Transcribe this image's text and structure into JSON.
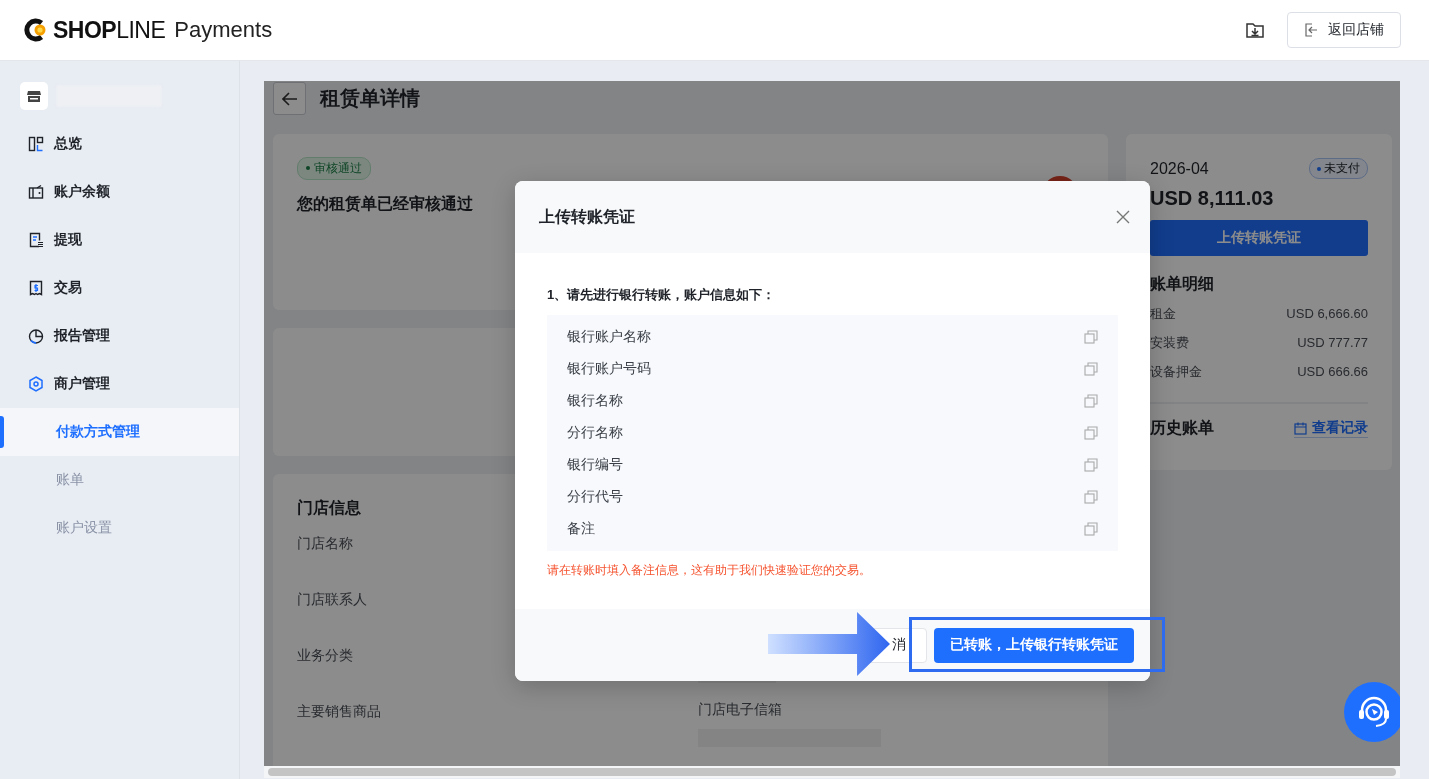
{
  "header": {
    "brand": "**SHOP**LINE",
    "product": "Payments",
    "back_button": "返回店铺"
  },
  "sidebar": {
    "items": [
      {
        "label": "总览",
        "expanded": false
      },
      {
        "label": "账户余额",
        "expanded": false
      },
      {
        "label": "提现",
        "expanded": false
      },
      {
        "label": "交易",
        "expanded": false
      },
      {
        "label": "报告管理",
        "expanded": false
      },
      {
        "label": "商户管理",
        "expanded": true,
        "children": [
          {
            "label": "付款方式管理",
            "selected": true
          },
          {
            "label": "账单",
            "selected": false
          },
          {
            "label": "账户设置",
            "selected": false
          }
        ]
      }
    ]
  },
  "page": {
    "title": "租赁单详情",
    "status_tag": "审核通过",
    "status_message": "您的租赁单已经审核通过",
    "store_info": {
      "title": "门店信息",
      "left_fields": [
        {
          "label": "门店名称"
        },
        {
          "label": "门店联系人"
        },
        {
          "label": "业务分类"
        },
        {
          "label": "主要销售商品"
        }
      ],
      "right_fields": [
        {
          "label": "门店电子信箱"
        }
      ]
    },
    "bill": {
      "period": "2026-04",
      "status": "未支付",
      "amount": "USD 8,111.03",
      "upload_button": "上传转账凭证",
      "details_title": "账单明细",
      "lines": [
        {
          "label": "租金",
          "amount": "USD 6,666.60"
        },
        {
          "label": "安装费",
          "amount": "USD 777.77"
        },
        {
          "label": "设备押金",
          "amount": "USD 666.66"
        }
      ],
      "history_title": "历史账单",
      "history_link": "查看记录"
    }
  },
  "modal": {
    "title": "上传转账凭证",
    "step": "1、请先进行银行转账，账户信息如下：",
    "fields": [
      {
        "label": "银行账户名称"
      },
      {
        "label": "银行账户号码"
      },
      {
        "label": "银行名称"
      },
      {
        "label": "分行名称"
      },
      {
        "label": "银行编号"
      },
      {
        "label": "分行代号"
      },
      {
        "label": "备注"
      }
    ],
    "note": "请在转账时填入备注信息，这有助于我们快速验证您的交易。",
    "cancel_button": "消",
    "confirm_button": "已转账，上传银行转账凭证"
  }
}
